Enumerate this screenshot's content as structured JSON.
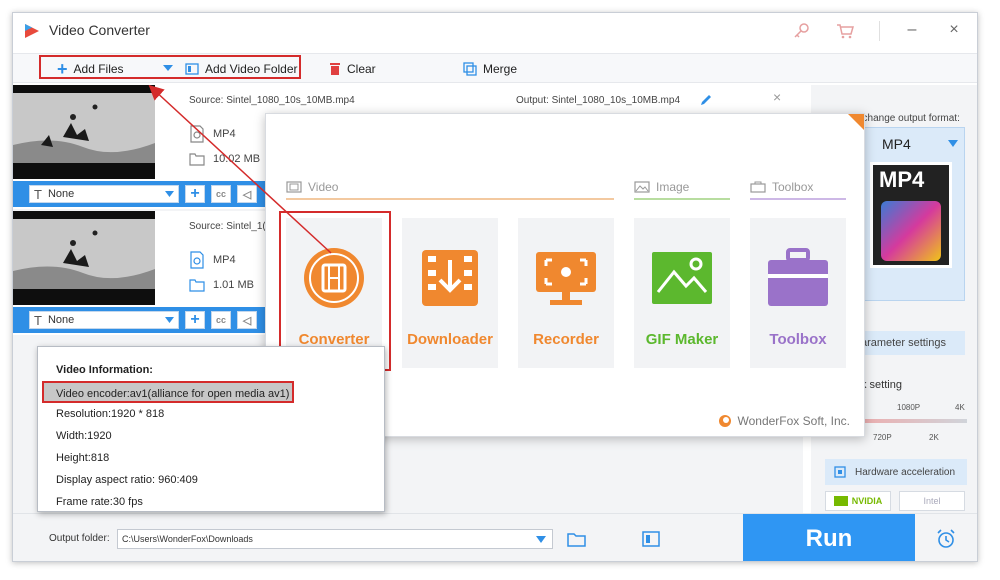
{
  "app": {
    "title": "Video Converter"
  },
  "toolbar": {
    "add_files": "Add Files",
    "add_video_folder": "Add Video Folder",
    "clear": "Clear",
    "merge": "Merge"
  },
  "files": [
    {
      "source": "Source: Sintel_1080_10s_10MB.mp4",
      "output": "Output: Sintel_1080_10s_10MB.mp4",
      "format": "MP4",
      "size": "10.02 MB",
      "subtitle": "None"
    },
    {
      "source": "Source: Sintel_1(",
      "format": "MP4",
      "size": "1.01 MB",
      "subtitle": "None"
    }
  ],
  "popup": {
    "sections": {
      "video": "Video",
      "image": "Image",
      "toolbox": "Toolbox"
    },
    "tiles": [
      {
        "label": "Converter",
        "color": "#f0882f"
      },
      {
        "label": "Downloader",
        "color": "#f0882f"
      },
      {
        "label": "Recorder",
        "color": "#f0882f"
      },
      {
        "label": "GIF Maker",
        "color": "#5cb82e"
      },
      {
        "label": "Toolbox",
        "color": "#9a72c9"
      }
    ],
    "brand": "WonderFox Soft, Inc."
  },
  "info": {
    "title": "Video Information:",
    "lines": [
      "Video encoder:av1(alliance for open media av1)",
      "Resolution:1920 * 818",
      "Width:1920",
      "Height:818",
      "Display aspect ratio: 960:409",
      "Frame rate:30 fps"
    ]
  },
  "right_panel": {
    "hint": "Click to change output format:",
    "format": "MP4",
    "card_label": "MP4",
    "param_settings": "arameter settings",
    "quality_label": "k setting",
    "quality_ticks_top": [
      "1080P",
      "4K"
    ],
    "quality_ticks_bottom": [
      "720P",
      "2K"
    ],
    "hw_accel": "Hardware acceleration",
    "nvidia": "NVIDIA",
    "intel": "Intel"
  },
  "bottom": {
    "output_label": "Output folder:",
    "output_path": "C:\\Users\\WonderFox\\Downloads",
    "run": "Run"
  },
  "colors": {
    "accent_blue": "#2f96f3",
    "orange": "#f0882f",
    "green": "#5cb82e",
    "purple": "#9a72c9",
    "highlight_red": "#d42b2b"
  }
}
